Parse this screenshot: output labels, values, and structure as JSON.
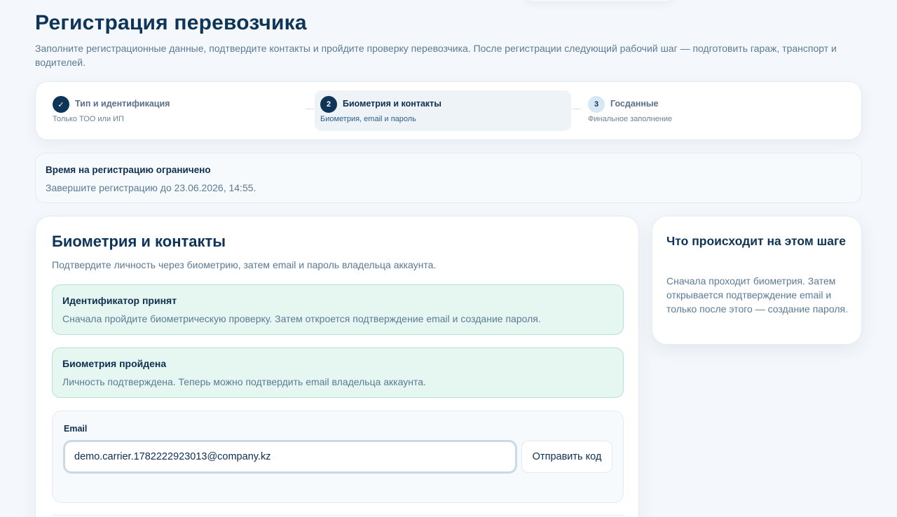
{
  "page": {
    "title": "Регистрация перевозчика",
    "subtitle": "Заполните регистрационные данные, подтвердите контакты и пройдите проверку перевозчика. После регистрации следующий рабочий шаг — подготовить гараж, транспорт и водителей."
  },
  "stepper": {
    "steps": [
      {
        "number": "✓",
        "title": "Тип и идентификация",
        "caption": "Только ТОО или ИП",
        "status": "done"
      },
      {
        "number": "2",
        "title": "Биометрия и контакты",
        "caption": "Биометрия, email и пароль",
        "status": "active"
      },
      {
        "number": "3",
        "title": "Госданные",
        "caption": "Финальное заполнение",
        "status": "pending"
      }
    ]
  },
  "notice": {
    "title": "Время на регистрацию ограничено",
    "text": "Завершите регистрацию до 23.06.2026, 14:55."
  },
  "main": {
    "title": "Биометрия и контакты",
    "description": "Подтвердите личность через биометрию, затем email и пароль владельца аккаунта.",
    "alerts": [
      {
        "title": "Идентификатор принят",
        "text": "Сначала пройдите биометрическую проверку. Затем откроется подтверждение email и создание пароля."
      },
      {
        "title": "Биометрия пройдена",
        "text": "Личность подтверждена. Теперь можно подтвердить email владельца аккаунта."
      }
    ],
    "email": {
      "label": "Email",
      "value": "demo.carrier.1782222923013@company.kz",
      "send_label": "Отправить код"
    }
  },
  "side": {
    "title": "Что происходит на этом шаге",
    "text": "Сначала проходит биометрия. Затем открывается подтверждение email и только после этого — создание пароля."
  },
  "colors": {
    "accent": "#0e3557",
    "success_bg": "#e6f6f0",
    "success_border": "#b7e1d0",
    "page_bg": "#f4f8fc"
  }
}
